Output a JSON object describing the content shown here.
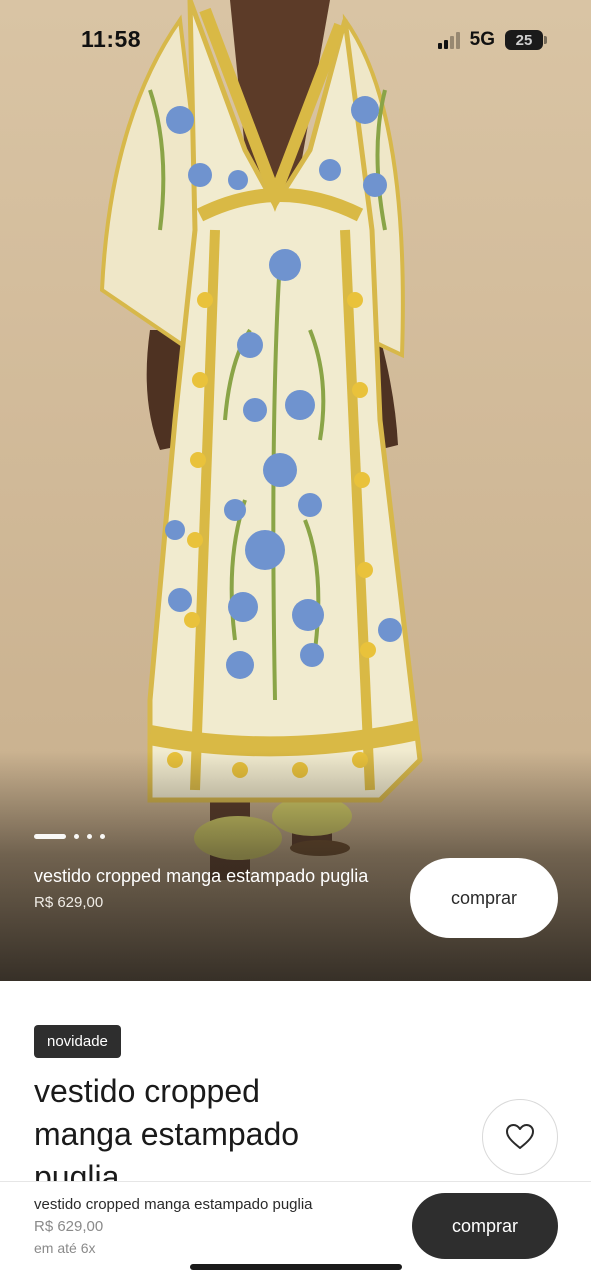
{
  "status_bar": {
    "time": "11:58",
    "network": "5G",
    "battery": "25"
  },
  "gallery": {
    "dot_count": 4,
    "active_index": 0
  },
  "hero": {
    "title": "vestido cropped manga estampado puglia",
    "price": "R$ 629,00",
    "buy_label": "comprar"
  },
  "details": {
    "badge": "novidade",
    "title": "vestido cropped manga estampado puglia"
  },
  "bottom_bar": {
    "title": "vestido cropped manga estampado puglia",
    "price": "R$ 629,00",
    "installments": "em até 6x",
    "buy_label": "comprar"
  },
  "icons": {
    "favorite": "heart-icon",
    "signal": "signal-icon",
    "battery": "battery-icon"
  },
  "colors": {
    "background_beige": "#d2bb9a",
    "dark_button": "#2e2e2e",
    "dress_cream": "#f1ebcf",
    "flower_blue": "#6f93cf",
    "leaf_green": "#8aa447",
    "accent_yellow": "#e9c23b"
  }
}
